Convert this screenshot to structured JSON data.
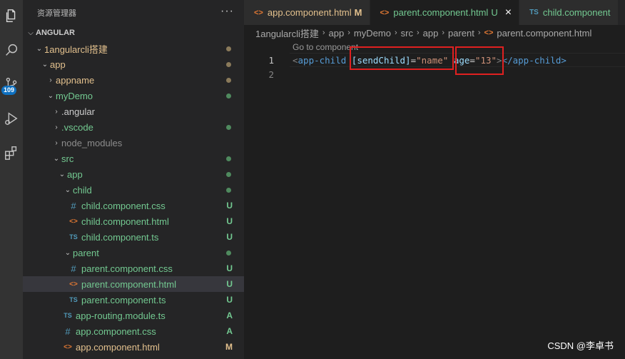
{
  "activity": {
    "items": [
      "explorer-icon",
      "search-icon",
      "source-control-icon",
      "run-debug-icon",
      "extensions-icon"
    ],
    "scm_badge": "109"
  },
  "sidebar": {
    "title": "资源管理器",
    "more": "···",
    "section": "ANGULAR",
    "tree": [
      {
        "label": "1angularcli搭建",
        "expanded": true,
        "depth": 1,
        "kind": "folder",
        "status": "dot-mod"
      },
      {
        "label": "app",
        "expanded": true,
        "depth": 2,
        "kind": "folder",
        "status": "dot-mod"
      },
      {
        "label": "appname",
        "expanded": false,
        "depth": 3,
        "kind": "folder",
        "status": "dot-mod"
      },
      {
        "label": "myDemo",
        "expanded": true,
        "depth": 3,
        "kind": "folder",
        "status": "dot-new"
      },
      {
        "label": ".angular",
        "expanded": false,
        "depth": 4,
        "kind": "folder",
        "status": ""
      },
      {
        "label": ".vscode",
        "expanded": false,
        "depth": 4,
        "kind": "folder",
        "status": "dot-new"
      },
      {
        "label": "node_modules",
        "expanded": false,
        "depth": 4,
        "kind": "folder",
        "status": ""
      },
      {
        "label": "src",
        "expanded": true,
        "depth": 4,
        "kind": "folder",
        "status": "dot-new"
      },
      {
        "label": "app",
        "expanded": true,
        "depth": 5,
        "kind": "folder",
        "status": "dot-new"
      },
      {
        "label": "child",
        "expanded": true,
        "depth": 6,
        "kind": "folder",
        "status": "dot-new"
      },
      {
        "label": "child.component.css",
        "depth": 7,
        "kind": "css",
        "status": "U"
      },
      {
        "label": "child.component.html",
        "depth": 7,
        "kind": "html",
        "status": "U"
      },
      {
        "label": "child.component.ts",
        "depth": 7,
        "kind": "ts",
        "status": "U"
      },
      {
        "label": "parent",
        "expanded": true,
        "depth": 6,
        "kind": "folder",
        "status": "dot-new"
      },
      {
        "label": "parent.component.css",
        "depth": 7,
        "kind": "css",
        "status": "U"
      },
      {
        "label": "parent.component.html",
        "depth": 7,
        "kind": "html",
        "status": "U",
        "selected": true
      },
      {
        "label": "parent.component.ts",
        "depth": 7,
        "kind": "ts",
        "status": "U"
      },
      {
        "label": "app-routing.module.ts",
        "depth": 6,
        "kind": "ts",
        "status": "A"
      },
      {
        "label": "app.component.css",
        "depth": 6,
        "kind": "css",
        "status": "A"
      },
      {
        "label": "app.component.html",
        "depth": 6,
        "kind": "html",
        "status": "M"
      }
    ]
  },
  "tabs": [
    {
      "label": "app.component.html",
      "status": "M",
      "icon": "html",
      "active": false
    },
    {
      "label": "parent.component.html",
      "status": "U",
      "icon": "html",
      "active": true,
      "close": "×"
    },
    {
      "label": "child.component",
      "status": "",
      "icon": "ts",
      "active": false
    }
  ],
  "breadcrumb": [
    "1angularcli搭建",
    "app",
    "myDemo",
    "src",
    "app",
    "parent",
    "parent.component.html"
  ],
  "editor": {
    "codelens": "Go to component",
    "line_numbers": [
      "1",
      "2"
    ],
    "line1": {
      "open": "<",
      "tag": "app-child",
      "attr1": "[sendChild]",
      "eq": "=",
      "val1": "\"name\"",
      "attr2": "age",
      "val2": "\"13\"",
      "close_open": ">",
      "end_tag": "</app-child>"
    }
  },
  "watermark": "CSDN @李卓书",
  "colors": {
    "accent_badge": "#0e70c0",
    "git_modified": "#e2c08d",
    "git_untracked": "#73c991",
    "highlight_box": "#e02020"
  }
}
